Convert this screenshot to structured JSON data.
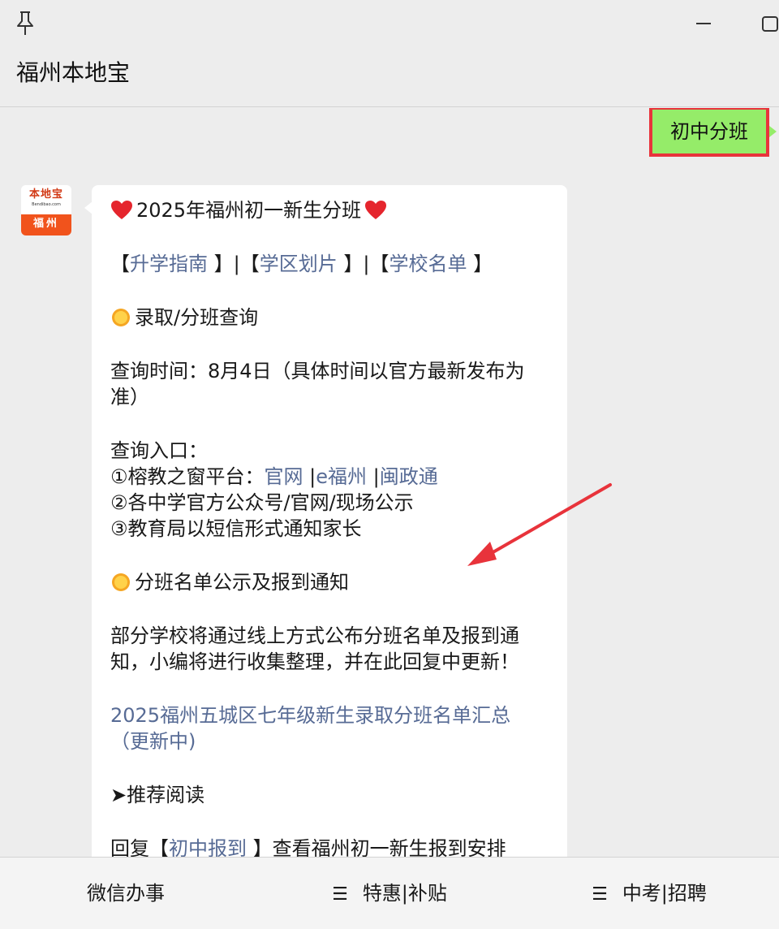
{
  "window": {
    "title": "福州本地宝",
    "controls": [
      "pin-icon",
      "minimize-icon",
      "maximize-icon"
    ]
  },
  "avatar": {
    "brand": "本地宝",
    "domain": "Bendibao.com",
    "city": "福州"
  },
  "outgoing_message": "初中分班",
  "incoming": {
    "heading": "2025年福州初一新生分班",
    "links_row": {
      "open1": "【",
      "link1": "升学指南",
      "close1": " 】",
      "sep1": "|",
      "open2": "【",
      "link2": "学区划片",
      "close2": " 】",
      "sep2": "|",
      "open3": "【",
      "link3": "学校名单",
      "close3": " 】"
    },
    "section1": "录取/分班查询",
    "query_time": "查询时间：8月4日（具体时间以官方最新发布为准）",
    "query_entry_label": "查询入口：",
    "entry1_prefix": "①榕教之窗平台：",
    "entry1_link1": "官网",
    "entry1_sep1": " |",
    "entry1_link2": "e福州",
    "entry1_sep2": " |",
    "entry1_link3": "闽政通",
    "entry2": "②各中学官方公众号/官网/现场公示",
    "entry3": "③教育局以短信形式通知家长",
    "section2": "分班名单公示及报到通知",
    "notice": "部分学校将通过线上方式公布分班名单及报到通知，小编将进行收集整理，并在此回复中更新！",
    "summary_link": "2025福州五城区七年级新生录取分班名单汇总（更新中)",
    "recommend": "➤推荐阅读",
    "reply_prefix": "回复【",
    "reply_link": "初中报到",
    "reply_suffix": " 】查看福州初一新生报到安排"
  },
  "bottom_menu": [
    {
      "label": "微信办事",
      "has_burger": false
    },
    {
      "label": "特惠|补贴",
      "has_burger": true
    },
    {
      "label": "中考|招聘",
      "has_burger": true
    }
  ],
  "colors": {
    "background": "#ededed",
    "bubble_out": "#95ec69",
    "highlight_border": "#e8333b",
    "link": "#576b95",
    "annotation_arrow": "#e8333b"
  }
}
